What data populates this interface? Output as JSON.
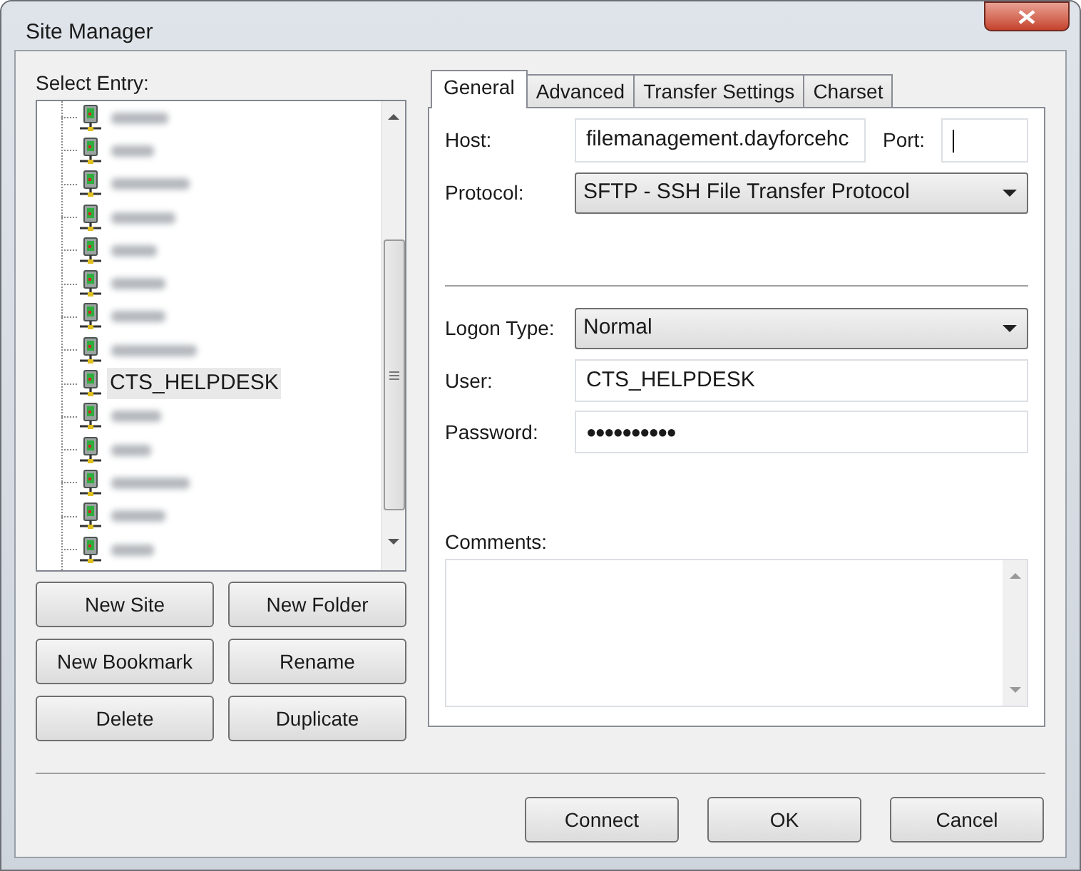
{
  "window": {
    "title": "Site Manager"
  },
  "entries": {
    "label": "Select Entry:",
    "items": [
      {
        "kind": "redacted",
        "selected": false
      },
      {
        "kind": "redacted",
        "selected": false
      },
      {
        "kind": "redacted",
        "selected": false
      },
      {
        "kind": "redacted",
        "selected": false
      },
      {
        "kind": "redacted",
        "selected": false
      },
      {
        "kind": "redacted",
        "selected": false
      },
      {
        "kind": "redacted",
        "selected": false
      },
      {
        "kind": "redacted",
        "selected": false
      },
      {
        "kind": "site",
        "label": "CTS_HELPDESK",
        "selected": true
      },
      {
        "kind": "redacted",
        "selected": false
      },
      {
        "kind": "redacted",
        "selected": false
      },
      {
        "kind": "redacted",
        "selected": false
      },
      {
        "kind": "redacted",
        "selected": false
      },
      {
        "kind": "redacted",
        "selected": false
      }
    ]
  },
  "buttons": [
    "New Site",
    "New Folder",
    "New Bookmark",
    "Rename",
    "Delete",
    "Duplicate"
  ],
  "tabs": [
    {
      "label": "General",
      "selected": true
    },
    {
      "label": "Advanced",
      "selected": false
    },
    {
      "label": "Transfer Settings",
      "selected": false
    },
    {
      "label": "Charset",
      "selected": false
    }
  ],
  "general": {
    "host_label": "Host:",
    "host": "filemanagement.dayforcehc",
    "port_label": "Port:",
    "protocol_label": "Protocol:",
    "protocol": "SFTP - SSH File Transfer Protocol",
    "logon_type_label": "Logon Type:",
    "logon_type": "Normal",
    "user_label": "User:",
    "user": "CTS_HELPDESK",
    "password_label": "Password:",
    "password": "●●●●●●●●●●",
    "comments_label": "Comments:"
  },
  "dialog_buttons": [
    "Connect",
    "OK",
    "Cancel"
  ]
}
